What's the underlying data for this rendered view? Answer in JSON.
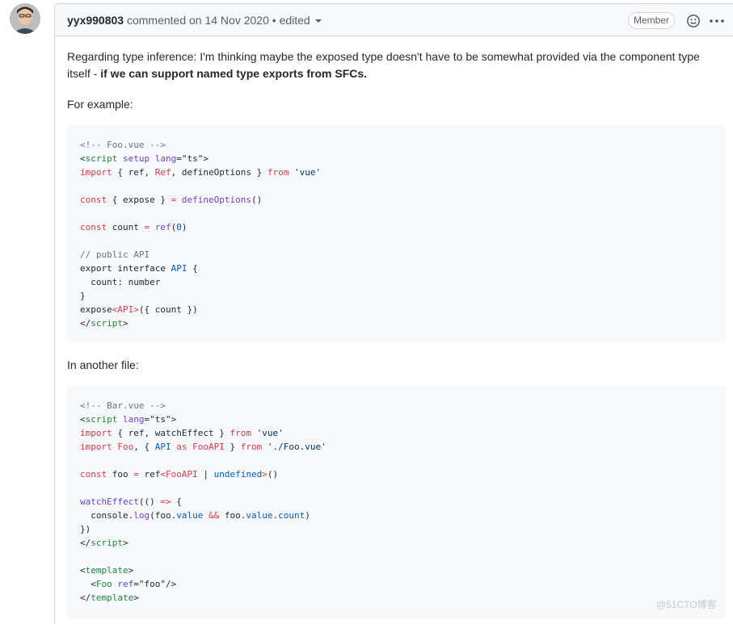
{
  "comment": {
    "author": "yyx990803",
    "action": "commented on",
    "date": "14 Nov 2020",
    "separator": "•",
    "edited_label": "edited",
    "member_badge": "Member",
    "avatar_icon": "user-avatar-icon",
    "emoji_icon": "smiley-icon",
    "more_icon": "kebab-horizontal-icon"
  },
  "body": {
    "para1_text": "Regarding type inference: I'm thinking maybe the exposed type doesn't have to be somewhat provided via the component type itself - ",
    "para1_bold": "if we can support named type exports from SFCs.",
    "para2": "For example:",
    "code1": [
      [
        [
          "<!-- Foo.vue -->",
          "comment"
        ]
      ],
      [
        [
          "<",
          "plain"
        ],
        [
          "script",
          "tag"
        ],
        [
          " ",
          "plain"
        ],
        [
          "setup",
          "fn"
        ],
        [
          " ",
          "plain"
        ],
        [
          "lang",
          "fn"
        ],
        [
          "=\"ts\">",
          "plain"
        ]
      ],
      [
        [
          "import",
          "kw"
        ],
        [
          " { ref, ",
          "plain"
        ],
        [
          "Ref",
          "kw"
        ],
        [
          ", defineOptions } ",
          "plain"
        ],
        [
          "from",
          "kw"
        ],
        [
          " 'vue'",
          "str"
        ]
      ],
      [],
      [
        [
          "const",
          "kw"
        ],
        [
          " { expose } ",
          "plain"
        ],
        [
          "=",
          "kw"
        ],
        [
          " ",
          "plain"
        ],
        [
          "defineOptions",
          "fn"
        ],
        [
          "()",
          "plain"
        ]
      ],
      [],
      [
        [
          "const",
          "kw"
        ],
        [
          " count ",
          "plain"
        ],
        [
          "=",
          "kw"
        ],
        [
          " ",
          "plain"
        ],
        [
          "ref",
          "fn"
        ],
        [
          "(",
          "plain"
        ],
        [
          "0",
          "ent"
        ],
        [
          ")",
          "plain"
        ]
      ],
      [],
      [
        [
          "// public API",
          "comment"
        ]
      ],
      [
        [
          "export interface ",
          "plain"
        ],
        [
          "API",
          "ent"
        ],
        [
          " {",
          "plain"
        ]
      ],
      [
        [
          "  count: number",
          "plain"
        ]
      ],
      [
        [
          "}",
          "plain"
        ]
      ],
      [
        [
          "expose",
          "plain"
        ],
        [
          "<API>",
          "kw"
        ],
        [
          "({ count })",
          "plain"
        ]
      ],
      [
        [
          "</",
          "plain"
        ],
        [
          "script",
          "tag"
        ],
        [
          ">",
          "plain"
        ]
      ]
    ],
    "para3": "In another file:",
    "code2": [
      [
        [
          "<!-- Bar.vue -->",
          "comment"
        ]
      ],
      [
        [
          "<",
          "plain"
        ],
        [
          "script",
          "tag"
        ],
        [
          " ",
          "plain"
        ],
        [
          "lang",
          "fn"
        ],
        [
          "=\"ts\">",
          "plain"
        ]
      ],
      [
        [
          "import",
          "kw"
        ],
        [
          " { ref, watchEffect } ",
          "plain"
        ],
        [
          "from",
          "kw"
        ],
        [
          " 'vue'",
          "str"
        ]
      ],
      [
        [
          "import",
          "kw"
        ],
        [
          " ",
          "plain"
        ],
        [
          "Foo",
          "kw"
        ],
        [
          ", { ",
          "plain"
        ],
        [
          "API",
          "ent"
        ],
        [
          " as ",
          "kw"
        ],
        [
          "FooAPI",
          "kw"
        ],
        [
          " } ",
          "plain"
        ],
        [
          "from",
          "kw"
        ],
        [
          " './Foo.vue'",
          "str"
        ]
      ],
      [],
      [
        [
          "const",
          "kw"
        ],
        [
          " foo ",
          "plain"
        ],
        [
          "=",
          "kw"
        ],
        [
          " ref",
          "plain"
        ],
        [
          "<",
          "kw"
        ],
        [
          "FooAPI",
          "kw"
        ],
        [
          " | ",
          "plain"
        ],
        [
          "undefined",
          "ent"
        ],
        [
          ">",
          "kw"
        ],
        [
          "()",
          "plain"
        ]
      ],
      [],
      [
        [
          "watchEffect",
          "fn"
        ],
        [
          "(() ",
          "plain"
        ],
        [
          "=>",
          "kw"
        ],
        [
          " {",
          "plain"
        ]
      ],
      [
        [
          "  console.",
          "plain"
        ],
        [
          "log",
          "fn"
        ],
        [
          "(foo.",
          "plain"
        ],
        [
          "value",
          "ent"
        ],
        [
          " ",
          "plain"
        ],
        [
          "&&",
          "kw"
        ],
        [
          " foo.",
          "plain"
        ],
        [
          "value",
          "ent"
        ],
        [
          ".",
          "plain"
        ],
        [
          "count",
          "ent"
        ],
        [
          ")",
          "plain"
        ]
      ],
      [
        [
          "})",
          "plain"
        ]
      ],
      [
        [
          "</",
          "plain"
        ],
        [
          "script",
          "tag"
        ],
        [
          ">",
          "plain"
        ]
      ],
      [],
      [
        [
          "<",
          "plain"
        ],
        [
          "template",
          "tag"
        ],
        [
          ">",
          "plain"
        ]
      ],
      [
        [
          "  <",
          "plain"
        ],
        [
          "Foo",
          "tag"
        ],
        [
          " ",
          "plain"
        ],
        [
          "ref",
          "fn"
        ],
        [
          "=\"foo\"/>",
          "plain"
        ]
      ],
      [
        [
          "</",
          "plain"
        ],
        [
          "template",
          "tag"
        ],
        [
          ">",
          "plain"
        ]
      ]
    ]
  },
  "watermark": "@51CTO博客"
}
